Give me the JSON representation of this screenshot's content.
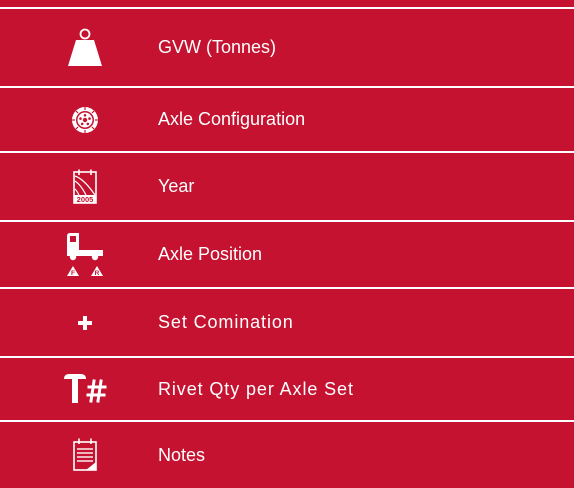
{
  "colors": {
    "background": "#c41230",
    "foreground": "#ffffff"
  },
  "rows": [
    {
      "icon": "weight-icon",
      "label": "GVW (Tonnes)"
    },
    {
      "icon": "wheel-icon",
      "label": "Axle Configuration"
    },
    {
      "icon": "calendar-year-icon",
      "label": "Year",
      "icon_text": "2005"
    },
    {
      "icon": "truck-axle-position-icon",
      "label": "Axle Position",
      "icon_text_front": "F",
      "icon_text_rear": "R"
    },
    {
      "icon": "plus-icon",
      "label": "Set Comination"
    },
    {
      "icon": "rivet-count-icon",
      "label": "Rivet Qty per Axle Set"
    },
    {
      "icon": "notes-icon",
      "label": "Notes"
    }
  ]
}
